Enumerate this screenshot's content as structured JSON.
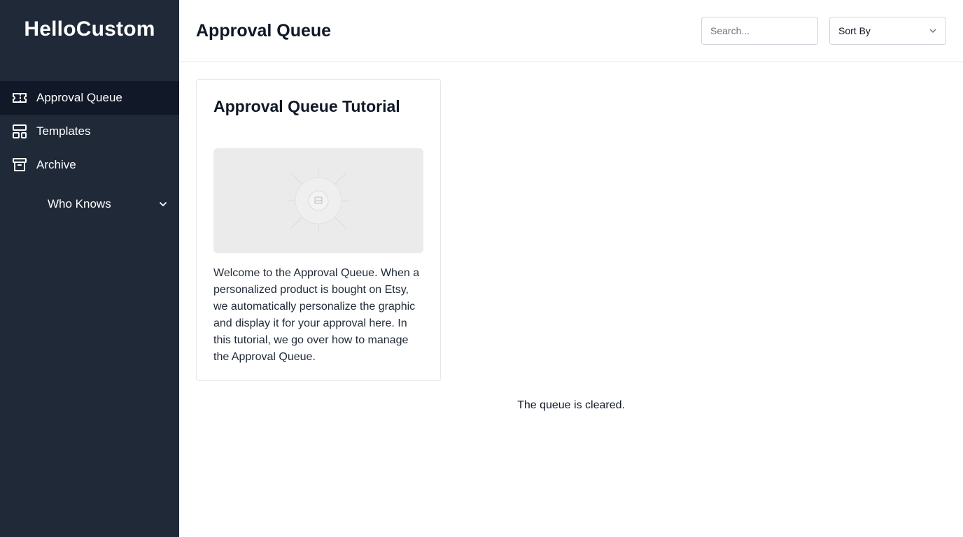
{
  "sidebar": {
    "brand": "HelloCustom",
    "items": [
      {
        "label": "Approval Queue",
        "icon": "ticket-icon",
        "active": true
      },
      {
        "label": "Templates",
        "icon": "templates-icon",
        "active": false
      },
      {
        "label": "Archive",
        "icon": "archive-icon",
        "active": false
      }
    ],
    "submenu": {
      "label": "Who Knows",
      "icon": "chevron-down-icon"
    }
  },
  "header": {
    "title": "Approval Queue",
    "search_placeholder": "Search...",
    "sort_label": "Sort By"
  },
  "card": {
    "title": "Approval Queue Tutorial",
    "thumbnail_icon": "video-thumbnail-icon",
    "text": "Welcome to the Approval Queue. When a personalized product is bought on Etsy, we automatically personalize the graphic and display it for your approval here. In this tutorial, we go over how to manage the Approval Queue."
  },
  "empty_message": "The queue is cleared.",
  "colors": {
    "sidebar_bg": "#1f2937",
    "active_item_bg": "#111827",
    "border": "#e5e7eb"
  }
}
